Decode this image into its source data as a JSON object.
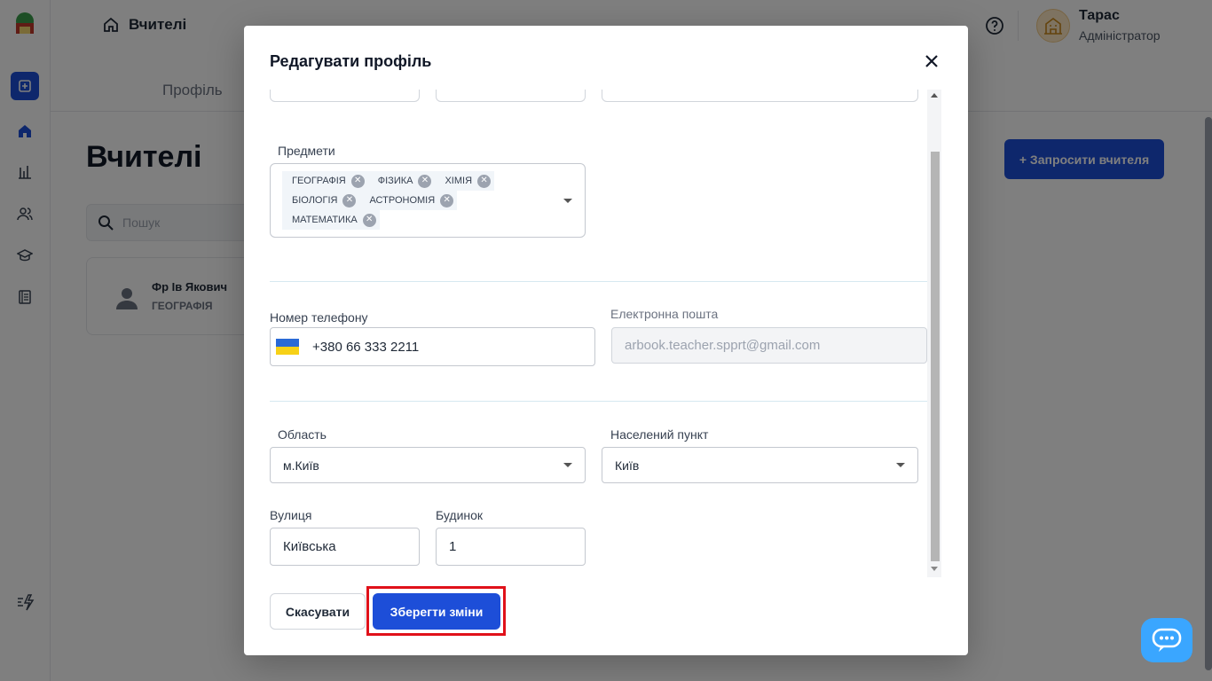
{
  "header": {
    "breadcrumb": "Вчителі",
    "tab_profile": "Профіль",
    "user_name": "Тарас",
    "user_role": "Адміністратор"
  },
  "page": {
    "title": "Вчителі",
    "invite_label": "+ Запросити вчителя",
    "search_placeholder": "Пошук",
    "teacher": {
      "name": "Фр Ів Якович",
      "subject": "ГЕОГРАФІЯ"
    }
  },
  "modal": {
    "title": "Редагувати профіль",
    "subjects_label": "Предмети",
    "subjects": [
      "ГЕОГРАФІЯ",
      "ФІЗИКА",
      "ХІМІЯ",
      "БІОЛОГІЯ",
      "АСТРОНОМІЯ",
      "МАТЕМАТИКА"
    ],
    "phone_label": "Номер телефону",
    "phone_value": "+380 66 333 2211",
    "email_label": "Електронна пошта",
    "email_value": "arbook.teacher.spprt@gmail.com",
    "region_label": "Область",
    "region_value": "м.Київ",
    "city_label": "Населений пункт",
    "city_value": "Київ",
    "street_label": "Вулиця",
    "street_value": "Київська",
    "house_label": "Будинок",
    "house_value": "1",
    "cancel_label": "Скасувати",
    "save_label": "Зберегти зміни"
  },
  "colors": {
    "primary": "#1d4ed8",
    "highlight": "#e0111a",
    "chat": "#3aa6ff"
  }
}
